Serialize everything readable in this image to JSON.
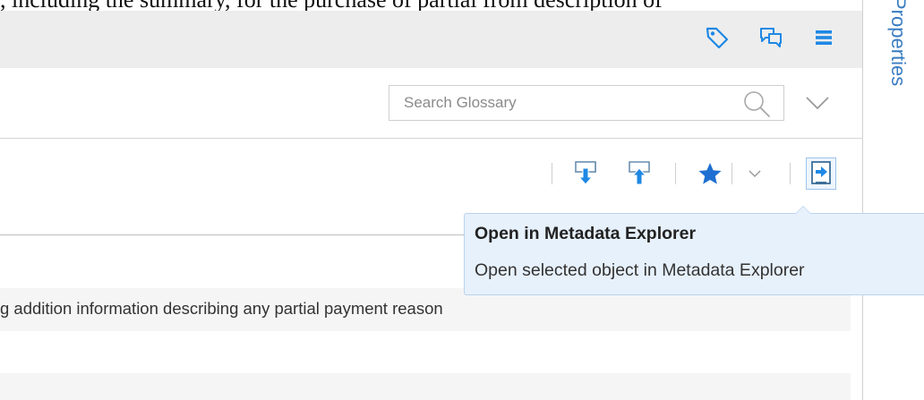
{
  "top_clip_text": ", including the summary, for the purchase of partial from description of",
  "header": {
    "icons": [
      "tag-icon",
      "comments-icon",
      "menu-icon"
    ]
  },
  "search": {
    "placeholder": "Search Glossary",
    "value": ""
  },
  "toolbar": {
    "icons": [
      "download-icon",
      "upload-icon",
      "favorite-star-icon",
      "favorite-dropdown-chevron-icon",
      "open-in-metadata-explorer-icon"
    ]
  },
  "tooltip": {
    "title": "Open in Metadata Explorer",
    "description": "Open selected object in Metadata Explorer"
  },
  "content": {
    "row_text": "g addition information describing any partial payment reason"
  },
  "side_panel": {
    "label": "Properties"
  },
  "colors": {
    "accent": "#1e88e5",
    "header_bg": "#ededed",
    "tooltip_bg": "#e7f1fc",
    "properties_label": "#3a7cc1"
  }
}
